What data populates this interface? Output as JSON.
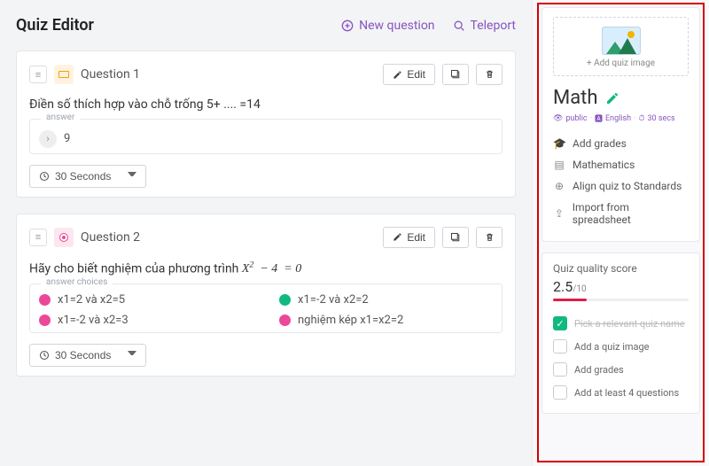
{
  "header": {
    "title": "Quiz Editor",
    "new_question": "New question",
    "teleport": "Teleport"
  },
  "questions": [
    {
      "label": "Question 1",
      "edit": "Edit",
      "body": "Điền số thích hợp vào chỗ trống 5+ .... =14",
      "answer_legend": "answer",
      "answer_value": "9",
      "time": "30 Seconds"
    },
    {
      "label": "Question 2",
      "edit": "Edit",
      "body_pre": "Hãy cho biết nghiệm của phương trình ",
      "body_eq": "X² − 4 = 0",
      "choices_legend": "answer choices",
      "choices": [
        {
          "text": "x1=2 và x2=5",
          "color": "pink"
        },
        {
          "text": "x1=-2 và x2=2",
          "color": "green"
        },
        {
          "text": "x1=-2 và x2=3",
          "color": "pink"
        },
        {
          "text": "nghiệm kép x1=x2=2",
          "color": "pink"
        }
      ],
      "time": "30 Seconds"
    }
  ],
  "sidebar": {
    "add_image": "+ Add quiz image",
    "quiz_name": "Math",
    "meta_public": "public",
    "meta_lang": "English",
    "meta_time": "30 secs",
    "options": {
      "grades": "Add grades",
      "subject": "Mathematics",
      "standards": "Align quiz to Standards",
      "import": "Import from spreadsheet"
    },
    "quality": {
      "title": "Quiz quality score",
      "score": "2.5",
      "max": "/10",
      "items": [
        {
          "label": "Pick a relevant quiz name",
          "done": true
        },
        {
          "label": "Add a quiz image",
          "done": false
        },
        {
          "label": "Add grades",
          "done": false
        },
        {
          "label": "Add at least 4 questions",
          "done": false
        }
      ]
    }
  }
}
